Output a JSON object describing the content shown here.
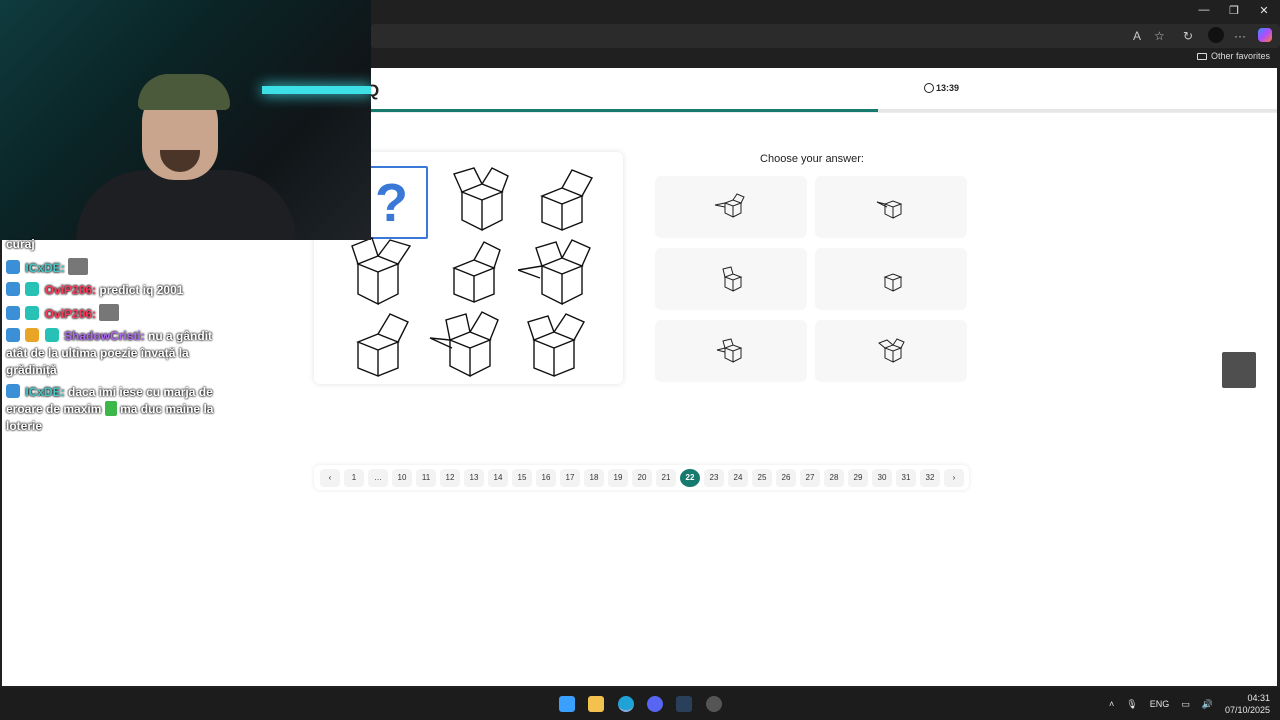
{
  "browser": {
    "favorites_label": "Other favorites"
  },
  "quiz": {
    "logo_text": "Q",
    "timer": "13:39",
    "progress": 0.56,
    "question_mark": "?",
    "choose_label": "Choose your answer:",
    "accent_color": "#177a6f",
    "highlight_color": "#3a78d8"
  },
  "pagination": {
    "prev": "‹",
    "next": "›",
    "pages": [
      "1",
      "…",
      "10",
      "11",
      "12",
      "13",
      "14",
      "15",
      "16",
      "17",
      "18",
      "19",
      "20",
      "21",
      "22",
      "23",
      "24",
      "25",
      "26",
      "27",
      "28",
      "29",
      "30",
      "31",
      "32"
    ],
    "active": "22"
  },
  "chat": {
    "messages": [
      {
        "user": "",
        "text": "curaj"
      },
      {
        "user": "ICxDE:",
        "text": ""
      },
      {
        "user": "OviP206:",
        "text": "predict iq 2001"
      },
      {
        "user": "OviP206:",
        "text": ""
      },
      {
        "user": "ShadowCristi:",
        "text": "nu a gândit atât de la ultima poezie învață la grădiniță"
      },
      {
        "user": "ICxDE:",
        "text": "daca imi iese cu marja de eroare de maxim"
      },
      {
        "user": "",
        "text": "ma duc maine la loterie"
      }
    ]
  },
  "taskbar": {
    "language": "ENG",
    "time": "04:31",
    "date": "07/10/2025"
  }
}
